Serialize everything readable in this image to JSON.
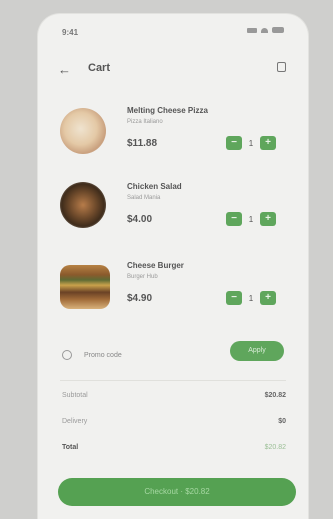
{
  "status_bar": {
    "time": "9:41"
  },
  "header": {
    "title": "Cart"
  },
  "items": [
    {
      "name": "Melting Cheese Pizza",
      "subtitle": "Pizza Italiano",
      "price": "$11.88",
      "quantity": "1"
    },
    {
      "name": "Chicken Salad",
      "subtitle": "Salad Mania",
      "price": "$4.00",
      "quantity": "1"
    },
    {
      "name": "Cheese Burger",
      "subtitle": "Burger Hub",
      "price": "$4.90",
      "quantity": "1"
    }
  ],
  "promo": {
    "label": "Promo code",
    "button": "Apply"
  },
  "summary": {
    "subtotal_label": "Subtotal",
    "subtotal_value": "$20.82",
    "delivery_label": "Delivery",
    "delivery_value": "$0",
    "total_label": "Total",
    "total_value": "$20.82"
  },
  "checkout": {
    "label": "Checkout · $20.82"
  },
  "colors": {
    "accent": "#5fa65c",
    "background": "#f1f1ef"
  }
}
